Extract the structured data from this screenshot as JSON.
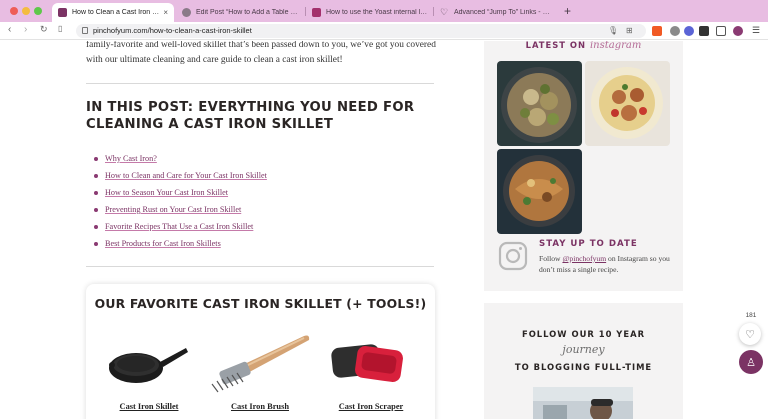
{
  "browser": {
    "tabs": [
      {
        "title": "How to Clean a Cast Iron Skillet",
        "active": true
      },
      {
        "title": "Edit Post “How to Add a Table of Co",
        "active": false
      },
      {
        "title": "How to use the Yoast internal linkin",
        "active": false
      },
      {
        "title": "Advanced “Jump To” Links - Feast",
        "active": false
      }
    ],
    "new_tab": "+",
    "url": "pinchofyum.com/how-to-clean-a-cast-iron-skillet",
    "nav": {
      "back": "‹",
      "forward": "›",
      "reload": "↻"
    }
  },
  "article": {
    "intro": "family-favorite and well-loved skillet that’s been passed down to you, we’ve got you covered with our ultimate cleaning and care guide to clean a cast iron skillet!",
    "toc_heading": "IN THIS POST: EVERYTHING YOU NEED FOR CLEANING A CAST IRON SKILLET",
    "toc_items": [
      "Why Cast Iron?",
      "How to Clean and Care for Your Cast Iron Skillet",
      "How to Season Your Cast Iron Skillet",
      "Preventing Rust on Your Cast Iron Skillet",
      "Favorite Recipes That Use a Cast Iron Skillet",
      "Best Products for Cast Iron Skillets"
    ],
    "tools_title": "OUR FAVORITE CAST IRON SKILLET (+ TOOLS!)",
    "tools": [
      {
        "label": "Cast Iron Skillet",
        "icon": "skillet-icon"
      },
      {
        "label": "Cast Iron Brush",
        "icon": "brush-icon"
      },
      {
        "label": "Cast Iron Scraper",
        "icon": "scraper-icon"
      }
    ]
  },
  "sidebar": {
    "latest_on": "LATEST ON",
    "instagram_script": "instagram",
    "stay_title": "STAY UP TO DATE",
    "stay_text_1": "Follow",
    "stay_handle": "@pinchofyum",
    "stay_text_2": "on Instagram so you don’t miss a single recipe.",
    "follow_1": "FOLLOW OUR 10 YEAR",
    "follow_journey": "journey",
    "follow_2": "TO BLOGGING FULL-TIME"
  },
  "floating": {
    "like_count": "181"
  },
  "colors": {
    "brand": "#7b3364",
    "tabbar": "#e8bde2",
    "sidebar_bg": "#f4f3f3"
  }
}
